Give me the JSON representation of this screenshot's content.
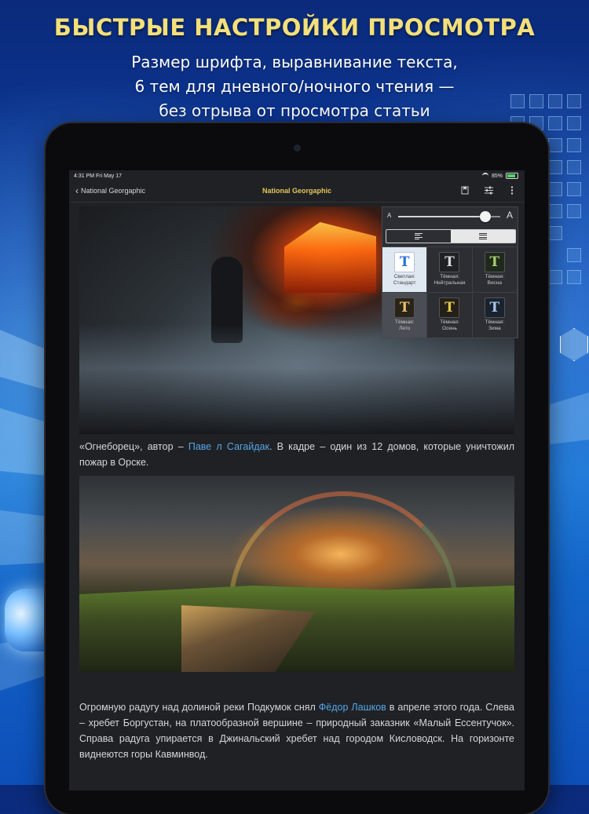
{
  "promo": {
    "headline": "БЫСТРЫЕ НАСТРОЙКИ ПРОСМОТРА",
    "subline": [
      "Размер шрифта, выравнивание текста,",
      "6 тем для дневного/ночного чтения —",
      "без отрыва от просмотра статьи"
    ]
  },
  "status_bar": {
    "time": "4:31 PM   Fri May 17",
    "battery": "85%"
  },
  "nav": {
    "back_label": "National Georgaphic",
    "title": "National Georgaphic",
    "icons": [
      "bookmark-icon",
      "settings-sliders-icon",
      "more-icon"
    ]
  },
  "article": {
    "caption1_before": "«Огнеборец», автор – ",
    "caption1_link": "Паве л Сагайдак",
    "caption1_after": ". В кадре – один из 12 домов, которые уничтожил пожар в Орске.",
    "caption2_before": "Огромную радугу над долиной реки Подкумок снял  ",
    "caption2_link": "Фёдор Лашков",
    "caption2_after": " в апреле этого года. Слева – хребет Боргустан, на платообразной вершине – природный заказник «Малый Ессентучок». Справа радуга упирается в Джинальский хребет над городом Кисловодск. На горизонте виднеются горы Кавминвод."
  },
  "settings": {
    "font_small": "A",
    "font_large": "A",
    "font_size_level": 0.85,
    "alignment_options": [
      "left",
      "justify"
    ],
    "alignment_selected": "justify",
    "theme_glyph": "T",
    "themes": [
      {
        "line1": "Светлая:",
        "line2": "Стандарт",
        "bg": "#ffffff",
        "fg": "#2a6fd6",
        "cell": "selected"
      },
      {
        "line1": "Тёмная:",
        "line2": "Нейтральная",
        "bg": "#1f2125",
        "fg": "#d8d8d8",
        "cell": "normal"
      },
      {
        "line1": "Тёмная:",
        "line2": "Весна",
        "bg": "#1f2a1c",
        "fg": "#a8d070",
        "cell": "normal"
      },
      {
        "line1": "Тёмная:",
        "line2": "Лето",
        "bg": "#2a2418",
        "fg": "#e6c26a",
        "cell": "dim"
      },
      {
        "line1": "Тёмная:",
        "line2": "Осень",
        "bg": "#241f18",
        "fg": "#e3c84a",
        "cell": "normal"
      },
      {
        "line1": "Тёмная:",
        "line2": "Зима",
        "bg": "#1a2230",
        "fg": "#a8c8e8",
        "cell": "normal"
      }
    ]
  }
}
